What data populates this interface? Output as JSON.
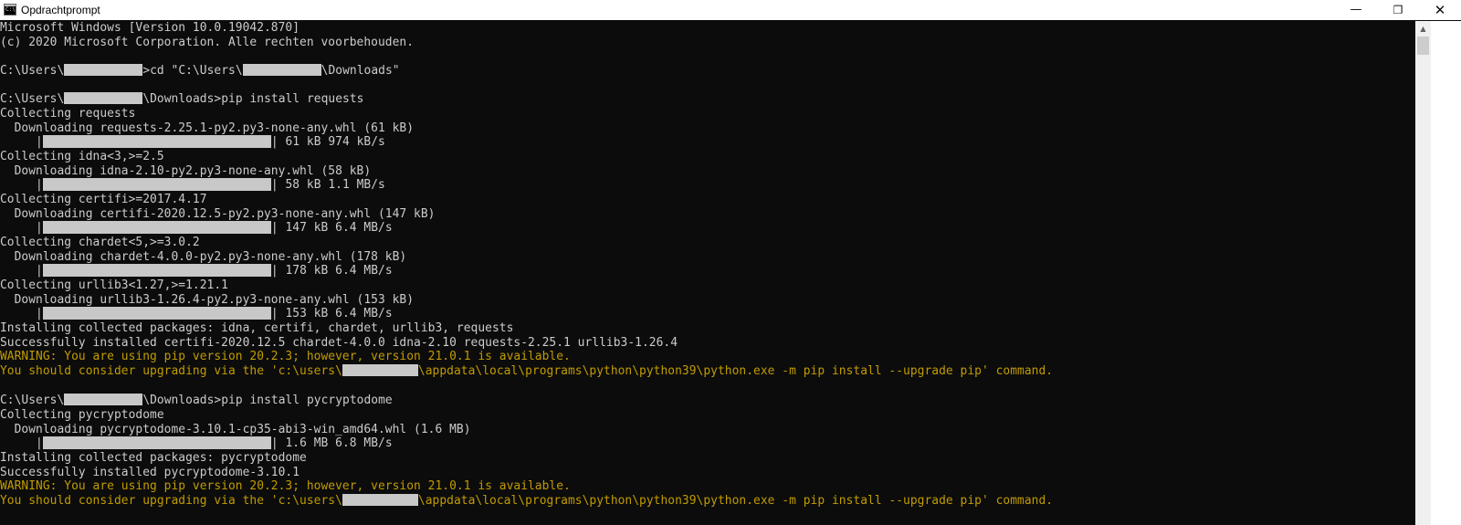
{
  "window": {
    "title": "Opdrachtprompt",
    "app_icon_text": "C:\\",
    "minimize_glyph": "—",
    "maximize_glyph": "❐",
    "close_glyph": "✕"
  },
  "scrollbar": {
    "up_arrow": "▲"
  },
  "colors": {
    "background": "#0c0c0c",
    "text": "#cccccc",
    "warning": "#c19c00",
    "redaction": "#c8c8c8"
  },
  "console": {
    "banner_1": "Microsoft Windows [Version 10.0.19042.870]",
    "banner_2": "(c) 2020 Microsoft Corporation. Alle rechten voorbehouden.",
    "prompt_users": "C:\\Users\\",
    "cd_cmd_mid": ">cd \"C:\\Users\\",
    "cd_cmd_end": "\\Downloads\"",
    "prompt_downloads_suffix": "\\Downloads>",
    "cmd_requests": "pip install requests",
    "collect_requests": "Collecting requests",
    "dl_requests": "  Downloading requests-2.25.1-py2.py3-none-any.whl (61 kB)",
    "progress_1": {
      "stats": "| 61 kB 974 kB/s",
      "fraction": 1.0
    },
    "collect_idna": "Collecting idna<3,>=2.5",
    "dl_idna": "  Downloading idna-2.10-py2.py3-none-any.whl (58 kB)",
    "progress_2": {
      "stats": "| 58 kB 1.1 MB/s",
      "fraction": 1.0
    },
    "collect_certifi": "Collecting certifi>=2017.4.17",
    "dl_certifi": "  Downloading certifi-2020.12.5-py2.py3-none-any.whl (147 kB)",
    "progress_3": {
      "stats": "| 147 kB 6.4 MB/s",
      "fraction": 1.0
    },
    "collect_chardet": "Collecting chardet<5,>=3.0.2",
    "dl_chardet": "  Downloading chardet-4.0.0-py2.py3-none-any.whl (178 kB)",
    "progress_4": {
      "stats": "| 178 kB 6.4 MB/s",
      "fraction": 1.0
    },
    "collect_urllib3": "Collecting urllib3<1.27,>=1.21.1",
    "dl_urllib3": "  Downloading urllib3-1.26.4-py2.py3-none-any.whl (153 kB)",
    "progress_5": {
      "stats": "| 153 kB 6.4 MB/s",
      "fraction": 1.0
    },
    "installing_1": "Installing collected packages: idna, certifi, chardet, urllib3, requests",
    "success_1": "Successfully installed certifi-2020.12.5 chardet-4.0.0 idna-2.10 requests-2.25.1 urllib3-1.26.4",
    "warning_1": "WARNING: You are using pip version 20.2.3; however, version 21.0.1 is available.",
    "upgrade_1_pre": "You should consider upgrading via the 'c:\\users\\",
    "upgrade_1_post": "\\appdata\\local\\programs\\python\\python39\\python.exe -m pip install --upgrade pip' command.",
    "cmd_pycryptodome": "pip install pycryptodome",
    "collect_pycryptodome": "Collecting pycryptodome",
    "dl_pycryptodome": "  Downloading pycryptodome-3.10.1-cp35-abi3-win_amd64.whl (1.6 MB)",
    "progress_6": {
      "stats": "| 1.6 MB 6.8 MB/s",
      "fraction": 1.0
    },
    "installing_2": "Installing collected packages: pycryptodome",
    "success_2": "Successfully installed pycryptodome-3.10.1",
    "warning_2": "WARNING: You are using pip version 20.2.3; however, version 21.0.1 is available.",
    "upgrade_2_pre": "You should consider upgrading via the 'c:\\users\\",
    "upgrade_2_post": "\\appdata\\local\\programs\\python\\python39\\python.exe -m pip install --upgrade pip' command.",
    "progress_prefix": "     |"
  }
}
